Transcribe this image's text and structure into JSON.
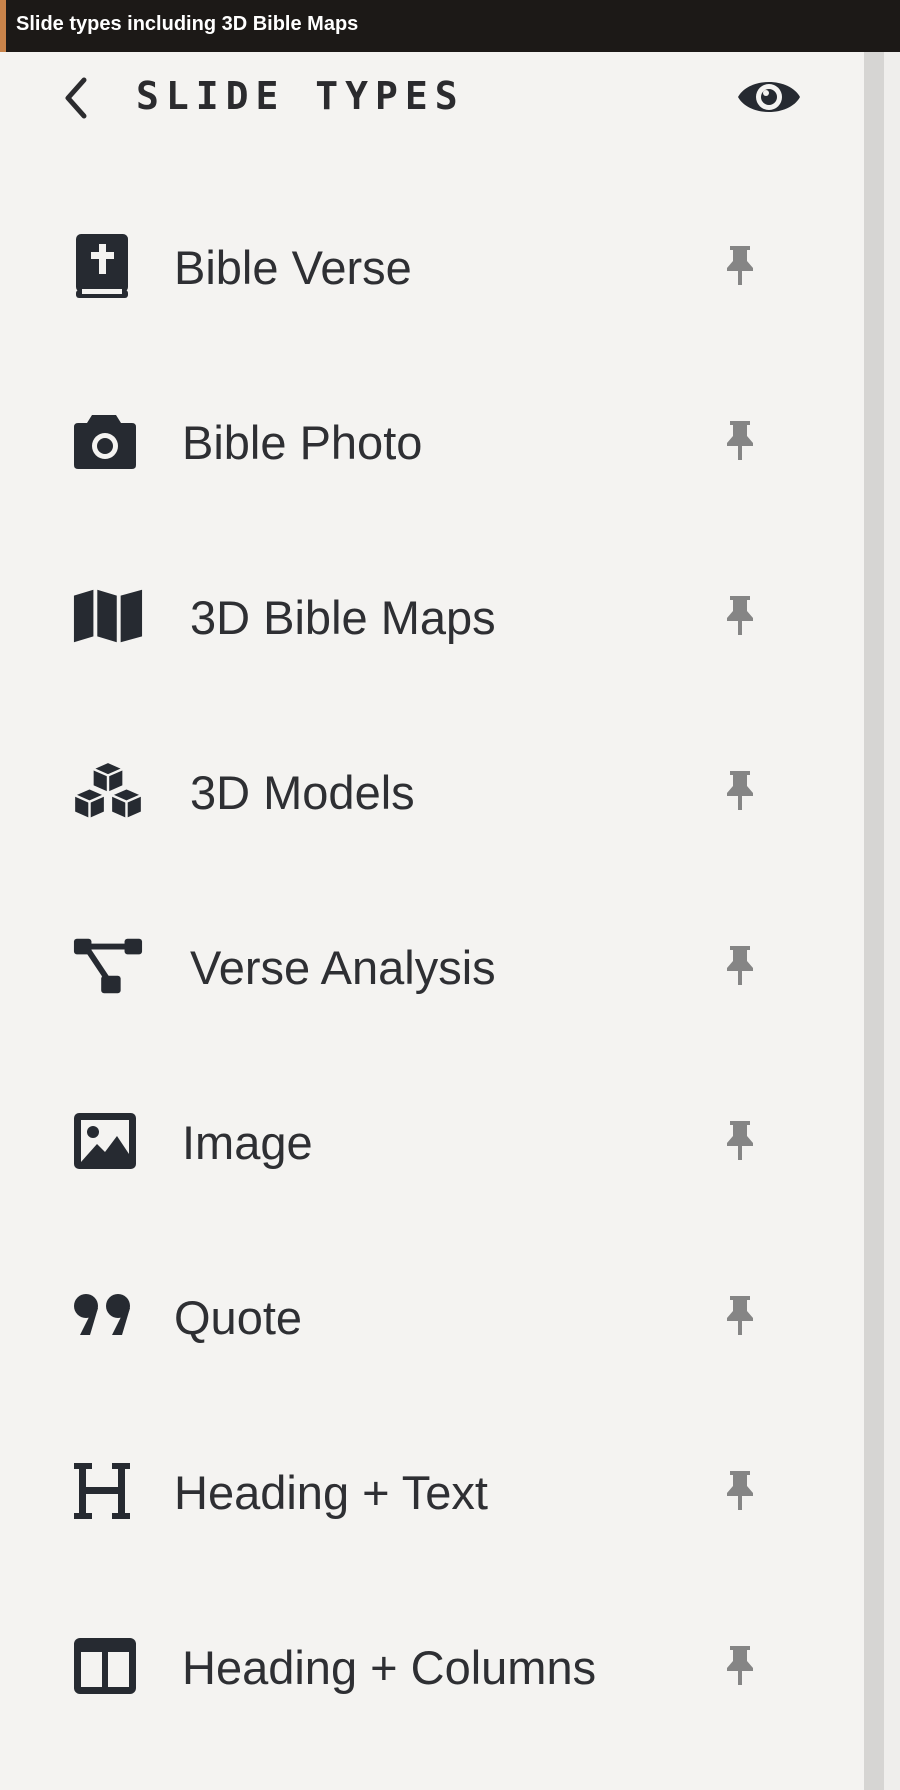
{
  "caption": {
    "text": "Slide types including 3D Bible Maps"
  },
  "header": {
    "title": "SLIDE TYPES",
    "back_icon": "chevron-left-icon",
    "visibility_icon": "eye-icon"
  },
  "slide_types": [
    {
      "label": "Bible Verse",
      "icon": "bible-icon",
      "pin_icon": "pin-icon"
    },
    {
      "label": "Bible Photo",
      "icon": "camera-icon",
      "pin_icon": "pin-icon"
    },
    {
      "label": "3D Bible Maps",
      "icon": "map-icon",
      "pin_icon": "pin-icon"
    },
    {
      "label": "3D Models",
      "icon": "cubes-icon",
      "pin_icon": "pin-icon"
    },
    {
      "label": "Verse Analysis",
      "icon": "diagram-icon",
      "pin_icon": "pin-icon"
    },
    {
      "label": "Image",
      "icon": "image-icon",
      "pin_icon": "pin-icon"
    },
    {
      "label": "Quote",
      "icon": "quote-icon",
      "pin_icon": "pin-icon"
    },
    {
      "label": "Heading + Text",
      "icon": "heading-icon",
      "pin_icon": "pin-icon"
    },
    {
      "label": "Heading + Columns",
      "icon": "columns-icon",
      "pin_icon": "pin-icon"
    }
  ],
  "colors": {
    "caption_background": "#1c1917",
    "caption_accent": "#c8834a",
    "panel_background": "#f4f3f1",
    "icon_color": "#262a31",
    "pin_color": "#858585"
  }
}
